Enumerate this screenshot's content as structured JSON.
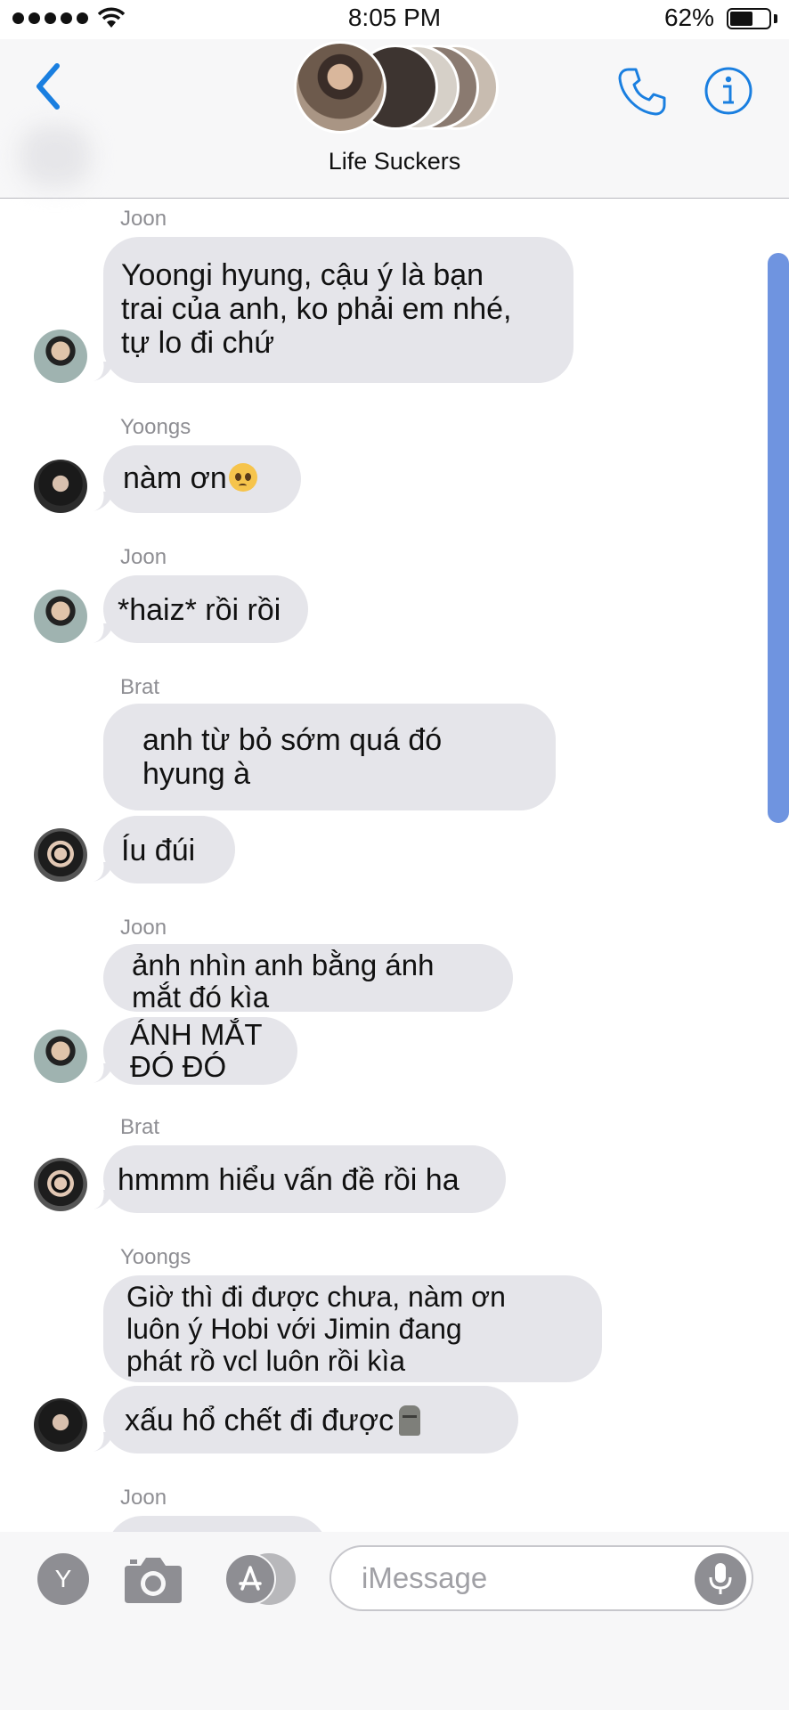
{
  "status_bar": {
    "time": "8:05 PM",
    "battery": "62%",
    "battery_level": 0.62
  },
  "header": {
    "group_name": "Life Suckers"
  },
  "messages": [
    {
      "sender": "Joon",
      "text": "Yoongi hyung, cậu ý là bạn\ntrai của anh, ko phải em nhé,\ntự lo đi chứ"
    },
    {
      "sender": "Yoongs",
      "text": "nàm ơn"
    },
    {
      "sender": "Joon",
      "text": "*haiz* rồi rồi"
    },
    {
      "sender": "Brat",
      "text": "anh từ bỏ sớm quá đó\nhyung à"
    },
    {
      "text": "Íu đúi"
    },
    {
      "sender": "Joon",
      "text": "ảnh nhìn anh bằng ánh\nmắt đó kìa"
    },
    {
      "text": "ÁNH MẮT\nĐÓ ĐÓ"
    },
    {
      "sender": "Brat",
      "text": "hmmm hiểu vấn đề rồi ha"
    },
    {
      "sender": "Yoongs",
      "text": "Giờ thì đi được chưa, nàm ơn\nluôn ý Hobi với Jimin đang\nphát rồ vcl luôn rồi kìa"
    },
    {
      "text": "xấu hổ chết đi được"
    },
    {
      "sender": "Joon"
    }
  ],
  "compose": {
    "placeholder": "iMessage",
    "apps_label": "Y"
  },
  "icons": [
    "back-chevron-icon",
    "phone-icon",
    "info-icon",
    "pleading-face-emoji",
    "moai-emoji",
    "camera-icon",
    "app-store-icon",
    "microphone-icon"
  ],
  "colors": {
    "accent": "#1a7fe0",
    "bubble": "#e5e5ea",
    "scrollbar": "#6f94e0"
  }
}
